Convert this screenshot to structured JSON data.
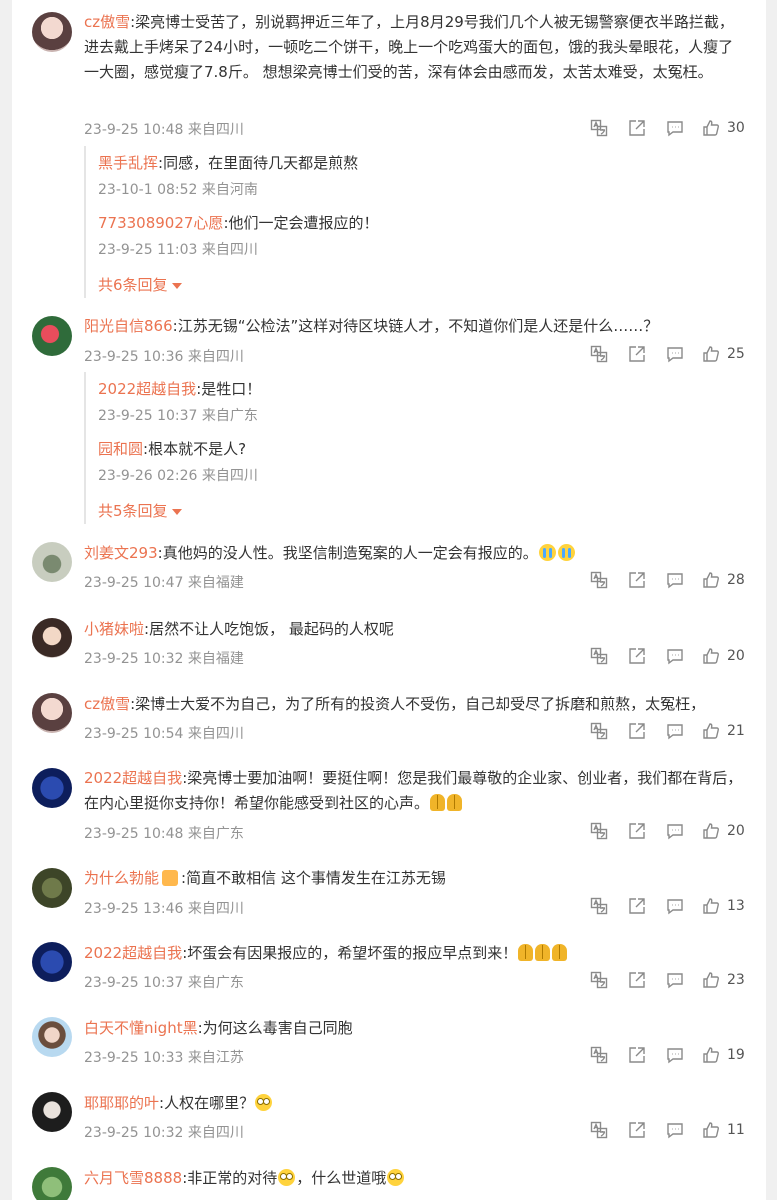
{
  "colors": {
    "username": "#eb7350",
    "meta": "#939393",
    "icon": "#8a8a8a"
  },
  "icons": [
    "translate-icon",
    "share-icon",
    "comment-icon",
    "thumbs-up-icon"
  ],
  "comments": [
    {
      "user": "cz傲雪",
      "text": ":梁亮博士受苦了，别说羁押近三年了，上月8月29号我们几个人被无锡警察便衣半路拦截，进去戴上手烤呆了24小时，一顿吃二个饼干，晚上一个吃鸡蛋大的面包，饿的我头晕眼花，人瘦了一大圈，感觉瘦了7.8斤。 想想梁亮博士们受的苦，深有体会由感而发，太苦太难受，太冤枉。",
      "time": "23-9-25 10:48 来自四川",
      "likes": "30",
      "replies": [
        {
          "user": "黑手乱挥",
          "text": ":同感，在里面待几天都是煎熬",
          "time": "23-10-1 08:52 来自河南"
        },
        {
          "user": "7733089027心愿",
          "text": ":他们一定会遭报应的！",
          "time": "23-9-25 11:03 来自四川"
        }
      ],
      "more": "共6条回复"
    },
    {
      "user": "阳光自信866",
      "text": ":江苏无锡“公检法”这样对待区块链人才，不知道你们是人还是什么……？",
      "time": "23-9-25 10:36 来自四川",
      "likes": "25",
      "replies": [
        {
          "user": "2022超越自我",
          "text": ":是牲口！",
          "time": "23-9-25 10:37 来自广东"
        },
        {
          "user": "园和圆",
          "text": ":根本就不是人?",
          "time": "23-9-26 02:26 来自四川"
        }
      ],
      "more": "共5条回复"
    },
    {
      "user": "刘姜文293",
      "text": ":真他妈的没人性。我坚信制造冤案的人一定会有报应的。",
      "time": "23-9-25 10:47 来自福建",
      "likes": "28"
    },
    {
      "user": "小猪妹啦",
      "text": ":居然不让人吃饱饭， 最起码的人权呢",
      "time": "23-9-25 10:32 来自福建",
      "likes": "20"
    },
    {
      "user": "cz傲雪",
      "text": ":梁博士大爱不为自己，为了所有的投资人不受伤，自己却受尽了拆磨和煎熬，太冤枉，",
      "time": "23-9-25 10:54 来自四川",
      "likes": "21"
    },
    {
      "user": "2022超越自我",
      "text": ":梁亮博士要加油啊！要挺住啊！您是我们最尊敬的企业家、创业者，我们都在背后，在内心里挺你支持你！希望你能感受到社区的心声。",
      "time": "23-9-25 10:48 来自广东",
      "likes": "20"
    },
    {
      "user": "为什么勃能",
      "text": ":简直不敢相信 这个事情发生在江苏无锡",
      "time": "23-9-25 13:46 来自四川",
      "likes": "13"
    },
    {
      "user": "2022超越自我",
      "text": ":坏蛋会有因果报应的，希望坏蛋的报应早点到来！",
      "time": "23-9-25 10:37 来自广东",
      "likes": "23"
    },
    {
      "user": "白天不懂night黑",
      "text": ":为何这么毒害自己同胞",
      "time": "23-9-25 10:33 来自江苏",
      "likes": "19"
    },
    {
      "user": "耶耶耶的叶",
      "text": ":人权在哪里？",
      "time": "23-9-25 10:32 来自四川",
      "likes": "11"
    },
    {
      "user": "六月飞雪8888",
      "text": ":非正常的对待",
      "text2": "，什么世道哦",
      "time": "",
      "likes": ""
    }
  ]
}
